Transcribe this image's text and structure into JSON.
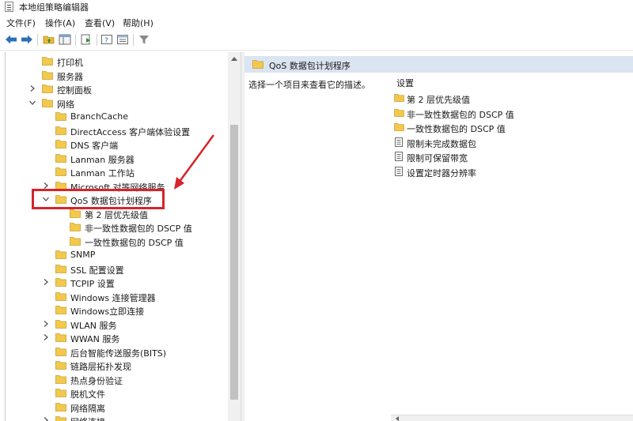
{
  "window": {
    "title": "本地组策略编辑器"
  },
  "menubar": {
    "items": [
      "文件(F)",
      "操作(A)",
      "查看(V)",
      "帮助(H)"
    ]
  },
  "toolbar": {
    "buttons": [
      "back-icon",
      "forward-icon",
      "up-folder-icon",
      "show-hide-tree-icon",
      "export-list-icon",
      "help-icon",
      "properties-icon",
      "filter-icon"
    ]
  },
  "tree": {
    "items": [
      {
        "label": "打印机",
        "depth": 1,
        "expander": "none"
      },
      {
        "label": "服务器",
        "depth": 1,
        "expander": "none"
      },
      {
        "label": "控制面板",
        "depth": 1,
        "expander": "collapsed"
      },
      {
        "label": "网络",
        "depth": 1,
        "expander": "expanded"
      },
      {
        "label": "BranchCache",
        "depth": 2,
        "expander": "none"
      },
      {
        "label": "DirectAccess 客户端体验设置",
        "depth": 2,
        "expander": "none"
      },
      {
        "label": "DNS 客户端",
        "depth": 2,
        "expander": "none"
      },
      {
        "label": "Lanman 服务器",
        "depth": 2,
        "expander": "none"
      },
      {
        "label": "Lanman 工作站",
        "depth": 2,
        "expander": "none"
      },
      {
        "label": "Microsoft 对等网络服务",
        "depth": 2,
        "expander": "collapsed"
      },
      {
        "label": "QoS 数据包计划程序",
        "depth": 2,
        "expander": "expanded",
        "selected": true
      },
      {
        "label": "第 2 层优先级值",
        "depth": 3,
        "expander": "none"
      },
      {
        "label": "非一致性数据包的 DSCP 值",
        "depth": 3,
        "expander": "none"
      },
      {
        "label": "一致性数据包的 DSCP 值",
        "depth": 3,
        "expander": "none"
      },
      {
        "label": "SNMP",
        "depth": 2,
        "expander": "none"
      },
      {
        "label": "SSL 配置设置",
        "depth": 2,
        "expander": "none"
      },
      {
        "label": "TCPIP 设置",
        "depth": 2,
        "expander": "collapsed"
      },
      {
        "label": "Windows 连接管理器",
        "depth": 2,
        "expander": "none"
      },
      {
        "label": "Windows立即连接",
        "depth": 2,
        "expander": "none"
      },
      {
        "label": "WLAN 服务",
        "depth": 2,
        "expander": "collapsed"
      },
      {
        "label": "WWAN 服务",
        "depth": 2,
        "expander": "collapsed"
      },
      {
        "label": "后台智能传送服务(BITS)",
        "depth": 2,
        "expander": "none"
      },
      {
        "label": "链路层拓扑发现",
        "depth": 2,
        "expander": "none"
      },
      {
        "label": "热点身份验证",
        "depth": 2,
        "expander": "none"
      },
      {
        "label": "脱机文件",
        "depth": 2,
        "expander": "none"
      },
      {
        "label": "网络隔离",
        "depth": 2,
        "expander": "none"
      },
      {
        "label": "网络连接",
        "depth": 2,
        "expander": "collapsed"
      }
    ]
  },
  "right_pane": {
    "header": "QoS 数据包计划程序",
    "description": "选择一个项目来查看它的描述。",
    "settings_header": "设置",
    "settings": [
      {
        "label": "第 2 层优先级值",
        "icon": "folder-icon"
      },
      {
        "label": "非一致性数据包的 DSCP 值",
        "icon": "folder-icon"
      },
      {
        "label": "一致性数据包的 DSCP 值",
        "icon": "folder-icon"
      },
      {
        "label": "限制未完成数据包",
        "icon": "policy-setting-icon"
      },
      {
        "label": "限制可保留带宽",
        "icon": "policy-setting-icon"
      },
      {
        "label": "设置定时器分辨率",
        "icon": "policy-setting-icon"
      }
    ]
  },
  "colors": {
    "selection_header": "#dbe4f1",
    "folder_fill": "#f2c94c",
    "annotation_red": "#d8232a"
  }
}
